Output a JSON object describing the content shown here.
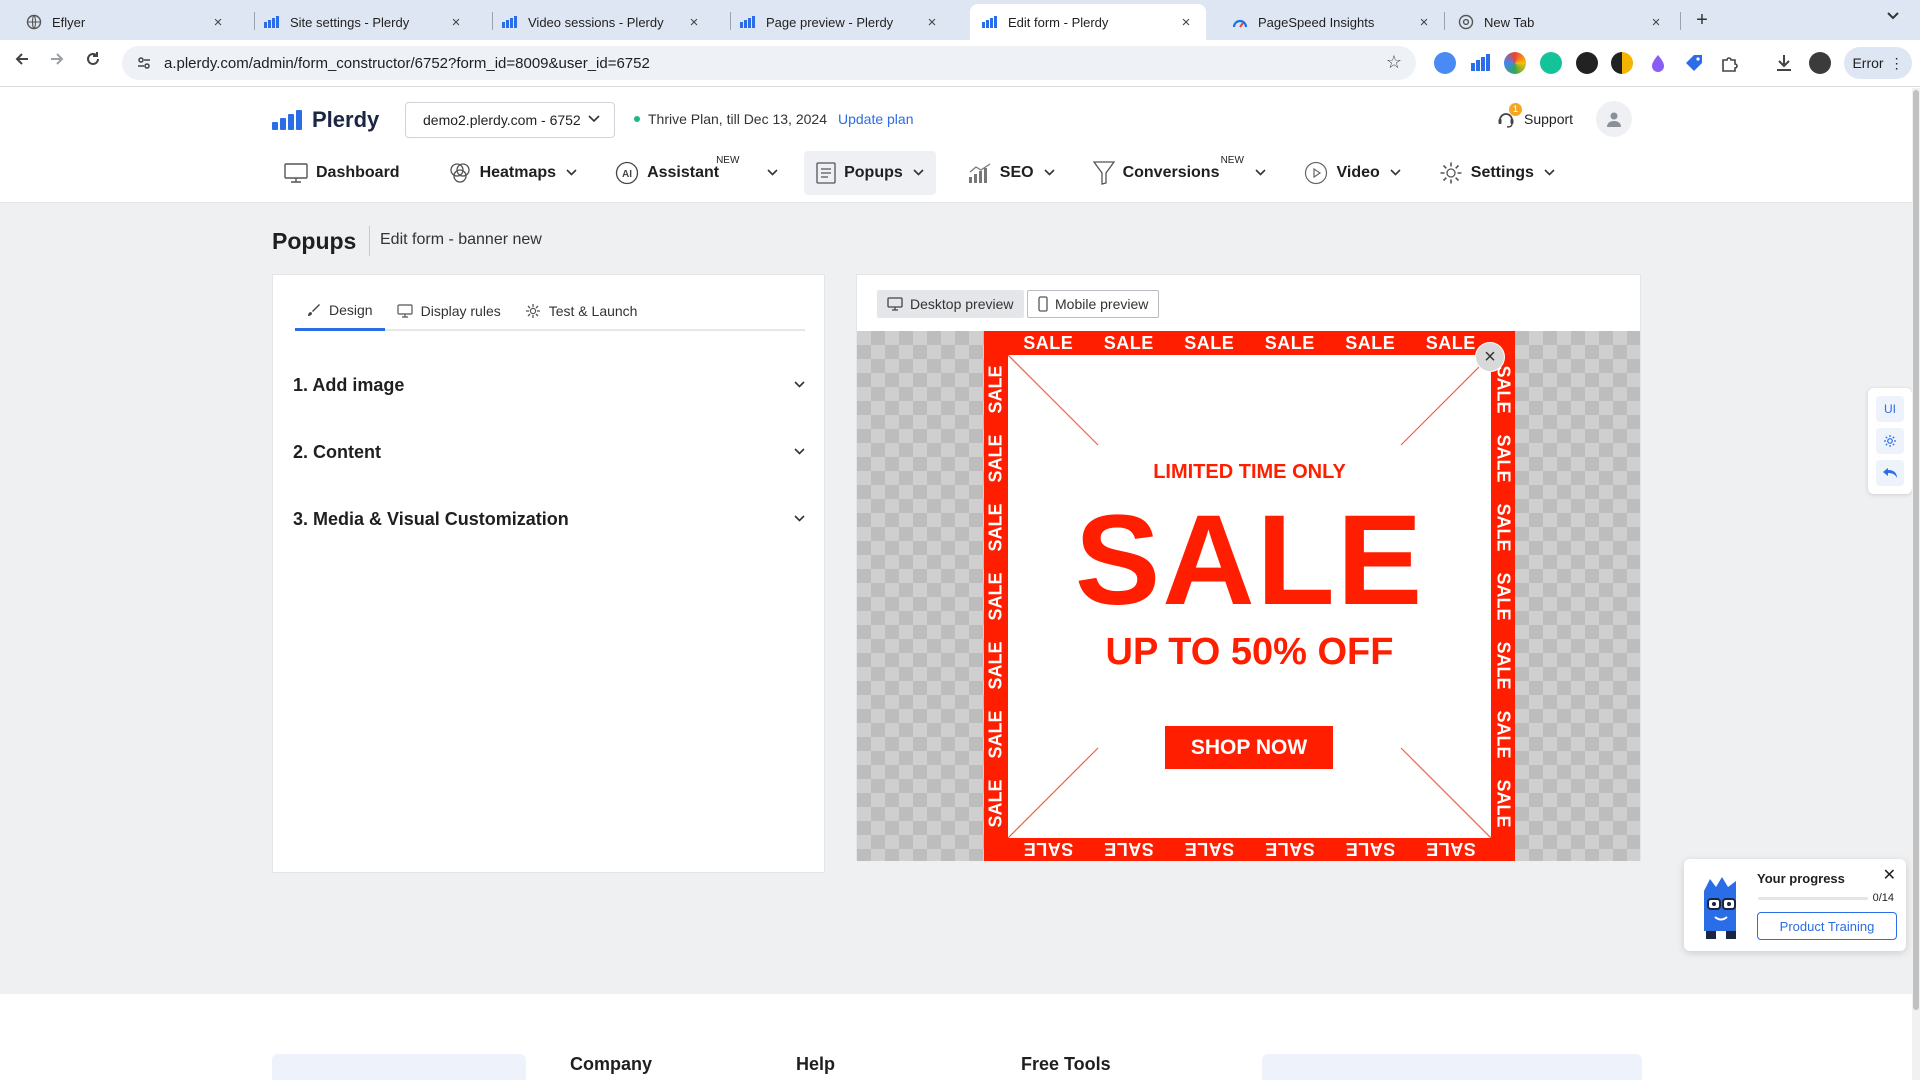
{
  "browser": {
    "tabs": [
      {
        "label": "Eflyer",
        "icon": "globe-icon"
      },
      {
        "label": "Site settings - Plerdy",
        "icon": "plerdy-icon"
      },
      {
        "label": "Video sessions - Plerdy",
        "icon": "plerdy-icon"
      },
      {
        "label": "Page preview - Plerdy",
        "icon": "plerdy-icon"
      },
      {
        "label": "Edit form - Plerdy",
        "icon": "plerdy-icon",
        "active": true
      },
      {
        "label": "PageSpeed Insights",
        "icon": "pagespeed-icon"
      },
      {
        "label": "New Tab",
        "icon": "chrome-icon"
      }
    ],
    "url": "a.plerdy.com/admin/form_constructor/6752?form_id=8009&user_id=6752",
    "error_label": "Error"
  },
  "header": {
    "logo_text": "Plerdy",
    "site_select": "demo2.plerdy.com - 6752",
    "plan_text": "Thrive Plan, till Dec 13, 2024",
    "update_plan": "Update plan",
    "support_label": "Support",
    "support_badge": "1"
  },
  "nav": {
    "items": [
      {
        "label": "Dashboard",
        "icon": "monitor-icon"
      },
      {
        "label": "Heatmaps",
        "icon": "heatmap-icon"
      },
      {
        "label": "Assistant",
        "icon": "ai-icon",
        "tag": "NEW"
      },
      {
        "label": "Popups",
        "icon": "document-icon"
      },
      {
        "label": "SEO",
        "icon": "chart-icon"
      },
      {
        "label": "Conversions",
        "icon": "funnel-icon",
        "tag": "NEW"
      },
      {
        "label": "Video",
        "icon": "play-icon"
      },
      {
        "label": "Settings",
        "icon": "gear-icon"
      }
    ]
  },
  "page": {
    "title": "Popups",
    "subtitle": "Edit form - banner new"
  },
  "left_panel": {
    "tabs": [
      {
        "label": "Design",
        "icon": "brush-icon"
      },
      {
        "label": "Display rules",
        "icon": "display-icon"
      },
      {
        "label": "Test & Launch",
        "icon": "gear-icon"
      }
    ],
    "sections": [
      "1. Add image",
      "2. Content",
      "3. Media & Visual Customization"
    ]
  },
  "preview": {
    "desktop_label": "Desktop preview",
    "mobile_label": "Mobile preview",
    "popup": {
      "border_word": "SALE",
      "limited": "LIMITED TIME ONLY",
      "headline": "SALE",
      "offer": "UP TO 50% OFF",
      "cta": "SHOP NOW",
      "close": "×"
    }
  },
  "side_tools": {
    "ui_label": "UI"
  },
  "progress_widget": {
    "title": "Your progress",
    "count": "0/14",
    "completed_fraction": 0,
    "button": "Product Training"
  },
  "footer": {
    "headings": [
      "Company",
      "Help",
      "Free Tools"
    ]
  },
  "colors": {
    "accent": "#2b6de6",
    "sale_red": "#ff1e00",
    "plan_dot": "#1eb980"
  }
}
